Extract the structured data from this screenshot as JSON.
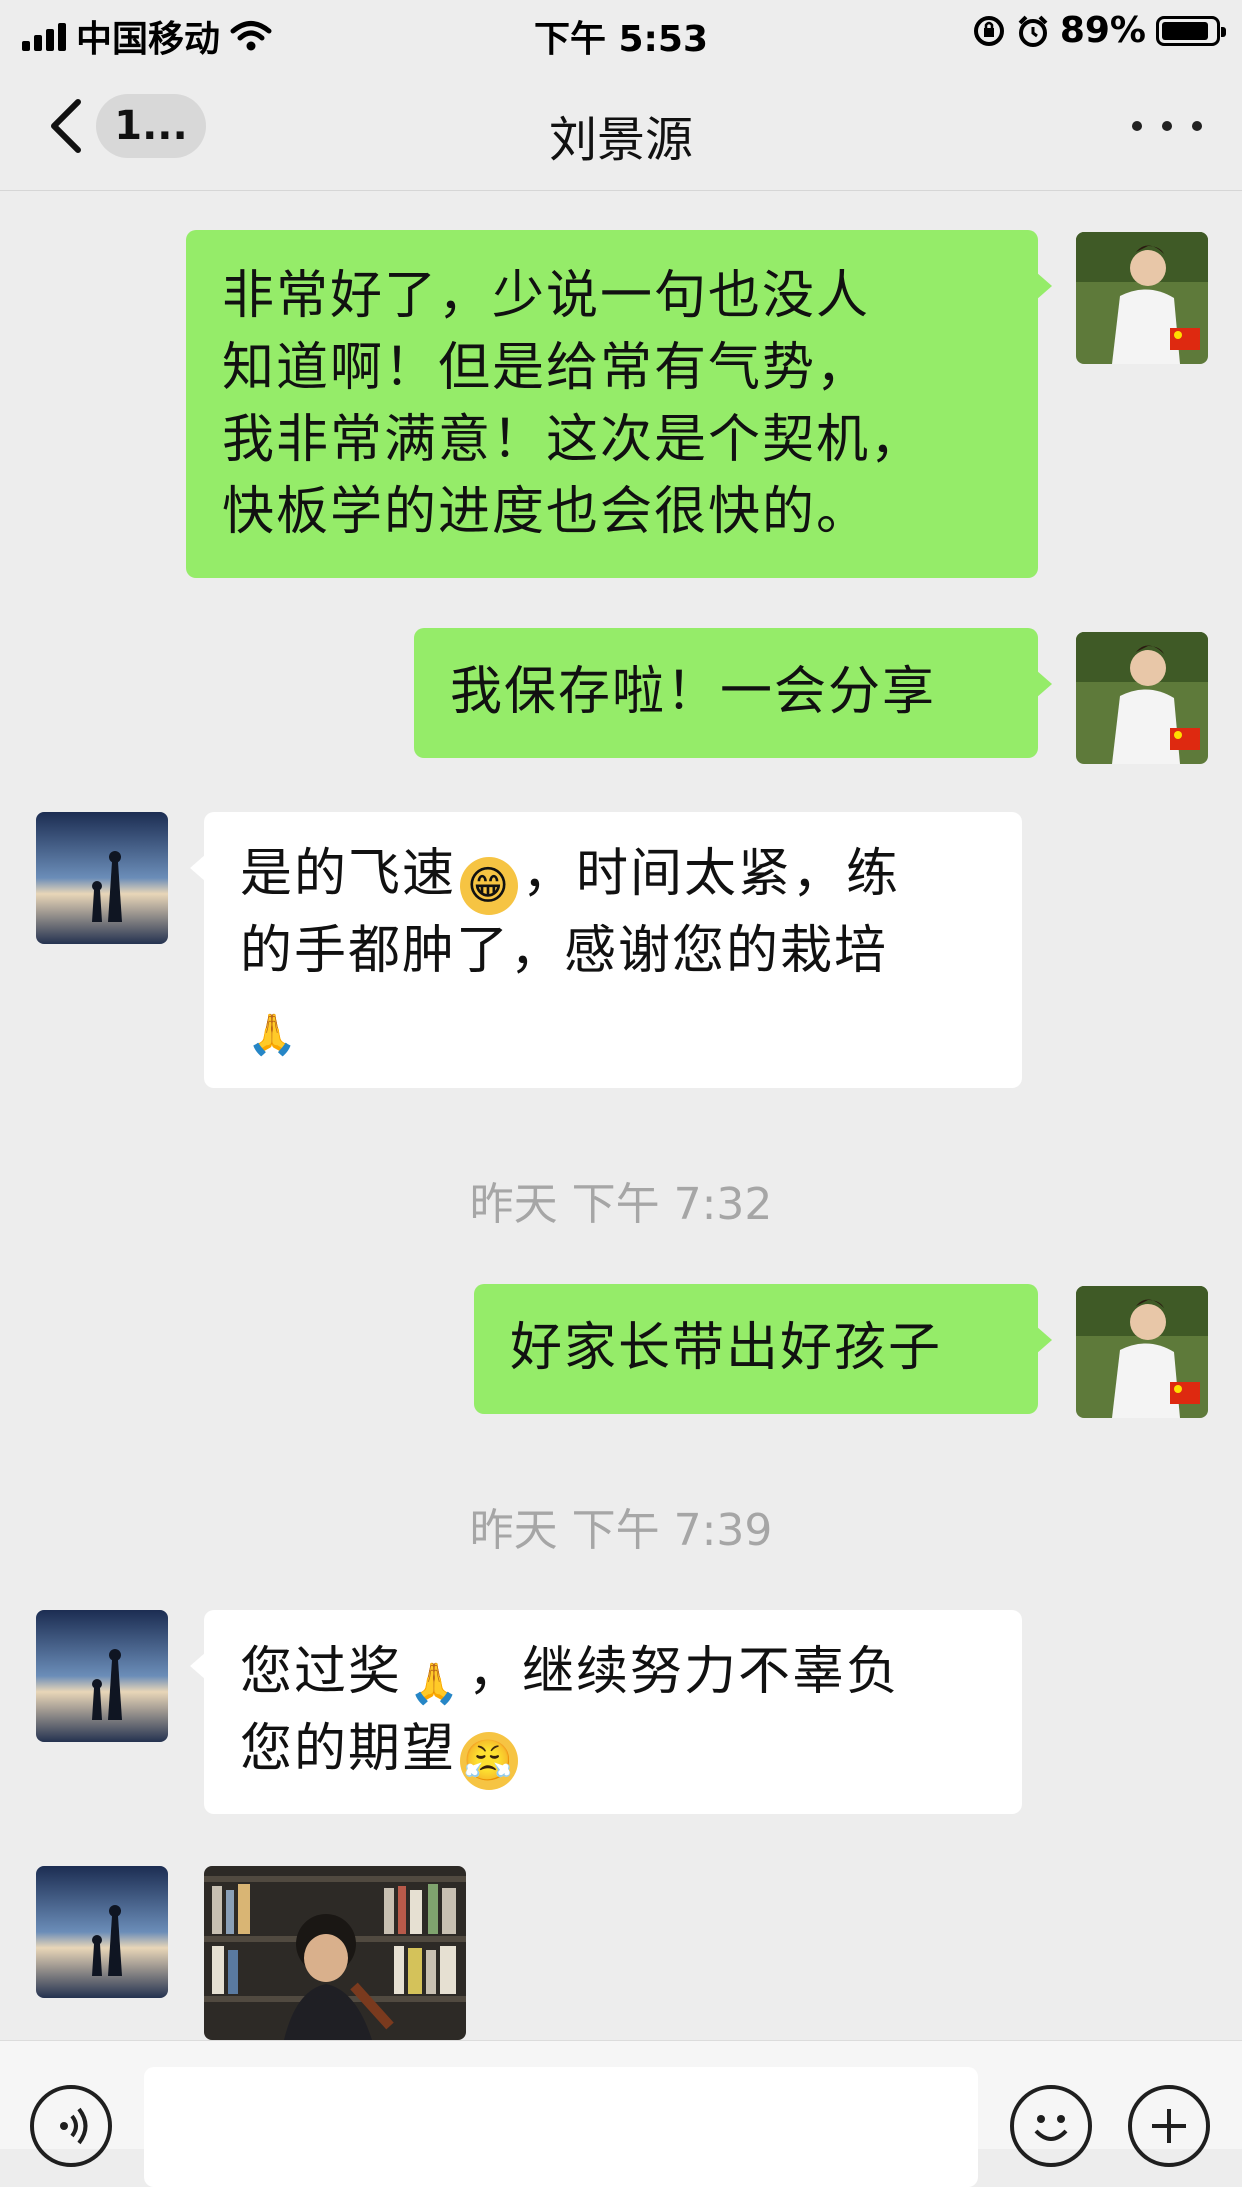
{
  "status_bar": {
    "carrier": "中国移动",
    "time": "下午 5:53",
    "battery": "89%",
    "battery_level": 0.89
  },
  "nav": {
    "unread_count": "1...",
    "title": "刘景源"
  },
  "messages": [
    {
      "sender": "me",
      "text": "非常好了，少说一句也没人知道啊！但是给常有气势，我非常满意！这次是个契机，快板学的进度也会很快的。",
      "lines": [
        "非常好了，少说一句也没人",
        "知道啊！但是给常有气势，",
        "我非常满意！这次是个契机，",
        "快板学的进度也会很快的。"
      ]
    },
    {
      "sender": "me",
      "text": "我保存啦！一会分享"
    },
    {
      "sender": "them",
      "lines": [
        "是的飞速",
        "，时间太紧，练",
        "的手都肿了，感谢您的栽培"
      ],
      "emojis": [
        "grin",
        "praying-hands"
      ]
    },
    {
      "sender": "system",
      "text": "昨天 下午 7:32"
    },
    {
      "sender": "me",
      "text": "好家长带出好孩子"
    },
    {
      "sender": "system",
      "text": "昨天 下午 7:39"
    },
    {
      "sender": "them",
      "lines": [
        "您过奖",
        "，继续努力不辜负",
        "您的期望"
      ],
      "emojis": [
        "praying-hands",
        "determined-face"
      ]
    },
    {
      "sender": "them",
      "type": "image",
      "description_icon": "photo-thumbnail"
    }
  ],
  "colors": {
    "background": "#ededed",
    "my_bubble": "#95ec69",
    "their_bubble": "#ffffff",
    "timestamp": "#a6a6a6"
  },
  "icons": {
    "back": "chevron-left-icon",
    "more": "more-dots-icon",
    "voice": "voice-icon",
    "emoji": "emoji-icon",
    "add": "plus-icon"
  }
}
